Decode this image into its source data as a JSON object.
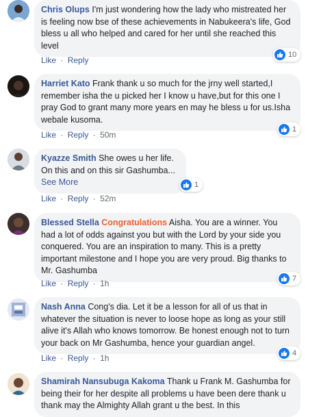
{
  "comments": [
    {
      "author": "Chris Olups",
      "text": "I'm just wondering how the lady who mistreated her is feeling now bse of these achievements in Nabukeera's life, God bless u all who helped and cared for her until she reached this level",
      "like": "Like",
      "reply": "Reply",
      "time": "",
      "reactions": "10"
    },
    {
      "author": "Harriet Kato",
      "text": "Frank thank u so much for the jrny well started,I remember isha the u picked her I know u have,but for this one I pray God to grant many more years en may he bless u for us.Isha webale kusoma.",
      "like": "Like",
      "reply": "Reply",
      "time": "50m",
      "reactions": "1"
    },
    {
      "author": "Kyazze Smith",
      "text": "She owes u her life. On this and on this sir Gashumba...",
      "see_more": "See More",
      "like": "Like",
      "reply": "Reply",
      "time": "52m",
      "reactions": "1"
    },
    {
      "author": "Blessed Stella",
      "highlight": "Congratulations",
      "text": "Aisha. You are a winner. You had a lot of odds against you but with the Lord by your side you conquered. You are an inspiration to many. This is a pretty important milestone and I hope you are very proud. Big thanks to Mr. Gashumba",
      "like": "Like",
      "reply": "Reply",
      "time": "1h",
      "reactions": "7"
    },
    {
      "author": "Nash Anna",
      "text": "Cong's dia. Let it be a lesson for all of us that in whatever the situation is never to loose hope as long as your still alive it's Allah who knows tomorrow. Be honest enough not to turn your back on Mr Gashumba, hence your guardian angel.",
      "like": "Like",
      "reply": "Reply",
      "time": "1h",
      "reactions": "4"
    },
    {
      "author": "Shamirah Nansubuga Kakoma",
      "text": "Thank u Frank M. Gashumba for being their for her despite all problems u have been dere thank u thank may the Almighty Allah grant u the best. In this",
      "like": "",
      "reply": "",
      "time": "",
      "reactions": ""
    }
  ],
  "colors": {
    "bubble": "#f2f3f5",
    "author": "#385898",
    "highlight": "#e8622c",
    "like_badge": "#1877f2"
  },
  "icons": {
    "reaction": "like-thumb-icon",
    "avatar": "profile-photo"
  }
}
